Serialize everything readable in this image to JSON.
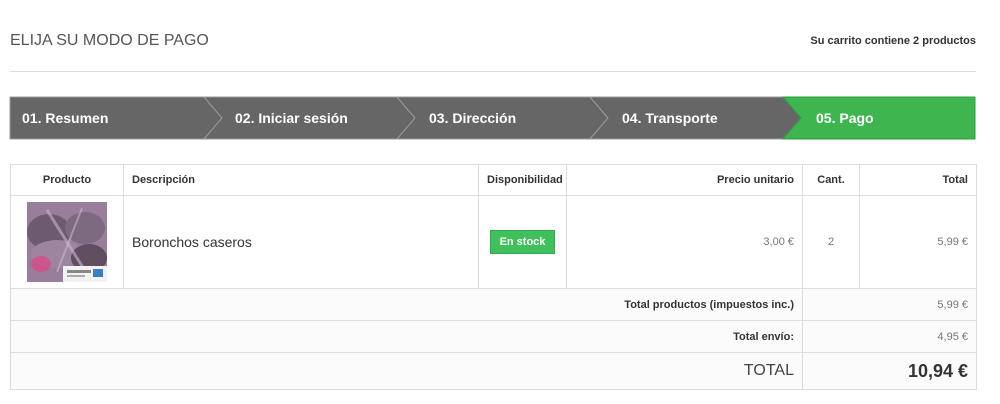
{
  "header": {
    "title": "ELIJA SU MODO DE PAGO",
    "cart_summary": "Su carrito contiene 2 productos"
  },
  "steps": [
    {
      "label": "01. Resumen",
      "state": "done"
    },
    {
      "label": "02. Iniciar sesión",
      "state": "done"
    },
    {
      "label": "03. Dirección",
      "state": "done"
    },
    {
      "label": "04. Transporte",
      "state": "done"
    },
    {
      "label": "05. Pago",
      "state": "current"
    }
  ],
  "colors": {
    "step_done": "#666666",
    "step_current": "#3fb550",
    "in_stock": "#3fc05c"
  },
  "table": {
    "headers": {
      "product": "Producto",
      "description": "Descripción",
      "availability": "Disponibilidad",
      "unit_price": "Precio unitario",
      "qty": "Cant.",
      "total": "Total"
    },
    "items": [
      {
        "image_icon": "product-thumbnail",
        "name": "Boronchos caseros",
        "availability": "En stock",
        "unit_price": "3,00 €",
        "qty": "2",
        "total": "5,99 €"
      }
    ],
    "totals": {
      "products_label": "Total productos (impuestos inc.)",
      "products_value": "5,99 €",
      "shipping_label": "Total envío:",
      "shipping_value": "4,95 €",
      "grand_label": "TOTAL",
      "grand_value": "10,94 €"
    }
  }
}
